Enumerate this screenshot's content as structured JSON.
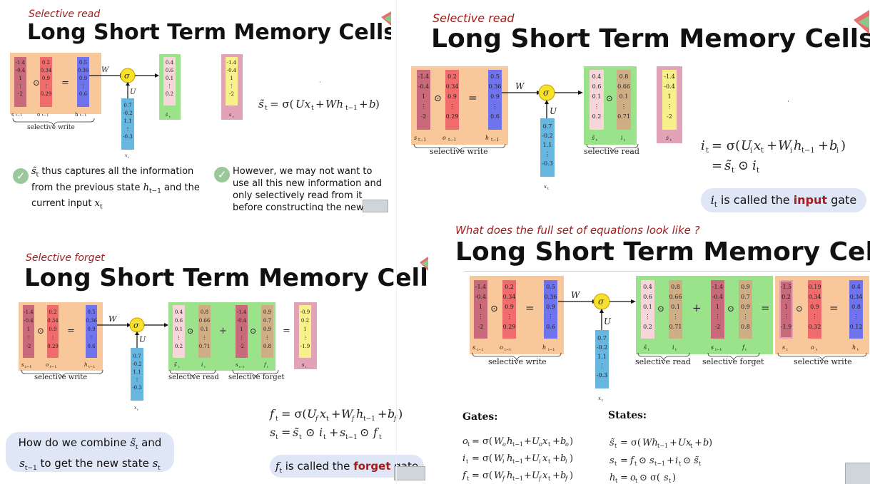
{
  "panels": {
    "p1": {
      "subtitle": "Selective read",
      "title": "Long Short Term Memory Cells",
      "bullet1": [
        "s̃",
        "t",
        " thus captures all the information",
        "from the previous state ",
        "h",
        "t−1",
        " and the",
        "current input ",
        "x",
        "t"
      ],
      "bullet2": "However, we may not want to use all this new information and only selectively read from it before constructing the new cell st..."
    },
    "p2": {
      "subtitle": "Selective read",
      "title": "Long Short Term Memory Cells",
      "pill_pre": "i",
      "pill_sub": "t",
      "pill_mid": " is called the ",
      "pill_hl": "input",
      "pill_post": " gate"
    },
    "p3": {
      "subtitle": "Selective forget",
      "title": "Long Short Term Memory Cells",
      "combine_line1": "How do we combine ",
      "combine_line2": " to get the new state ",
      "pill_mid": " is called the ",
      "pill_hl": "forget",
      "pill_post": " gate"
    },
    "p4": {
      "subtitle": "What does the full set of equations look like ?",
      "title": "Long Short Term Memory Cells",
      "gates_heading": "Gates:",
      "states_heading": "States:"
    }
  },
  "vectors": {
    "s_prev": [
      "-1.4",
      "-0.4",
      "1",
      "⋮",
      "-2"
    ],
    "o_prev": [
      "0.2",
      "0.34",
      "0.9",
      "⋮",
      "0.29"
    ],
    "h_prev": [
      "0.5",
      "0.36",
      "0.9",
      "⋮",
      "0.6"
    ],
    "x_t": [
      "0.7",
      "-0.2",
      "1.1",
      "⋮",
      "-0.3"
    ],
    "s_tilde_p1": [
      "0.4",
      "0.6",
      "0.1",
      "⋮",
      "0.2"
    ],
    "s_tilde": [
      "0.4",
      "0.6",
      "0.1",
      "⋮",
      "0.2"
    ],
    "i_t": [
      "0.8",
      "0.66",
      "0.1",
      "⋮",
      "0.71"
    ],
    "f_t": [
      "0.9",
      "0.7",
      "0.9",
      "⋮",
      "0.8"
    ],
    "s_t_p3": [
      "-0.9",
      "0.2",
      "1",
      "⋮",
      "-1.9"
    ],
    "s_t_p4": [
      "-1.5",
      "0.2",
      "1",
      "⋮",
      "-1.9"
    ],
    "o_t": [
      "0.19",
      "0.34",
      "0.9",
      "⋮",
      "0.32"
    ],
    "h_t": [
      "0.4",
      "0.34",
      "0.8",
      "⋮",
      "0.12"
    ],
    "s_t_panel1": [
      "-1.4",
      "-0.4",
      "1",
      "⋮",
      "-2"
    ]
  },
  "labels": {
    "selective_write": "selective write",
    "selective_read": "selective read",
    "selective_forget": "selective forget"
  },
  "colors": {
    "orange": "#f8c79a",
    "green": "#9be38a",
    "pink": "#e3a3b7",
    "red_col": "#f06c6c",
    "maroon_col": "#c96a7a",
    "blue_col": "#6f74ee",
    "light_blue": "#67b6e0",
    "yellow": "#f8e12a",
    "tan": "#cfae86",
    "light_pink": "#f7d6da",
    "pale_yellow": "#f8f08a",
    "accent_red": "#a11d1d"
  }
}
